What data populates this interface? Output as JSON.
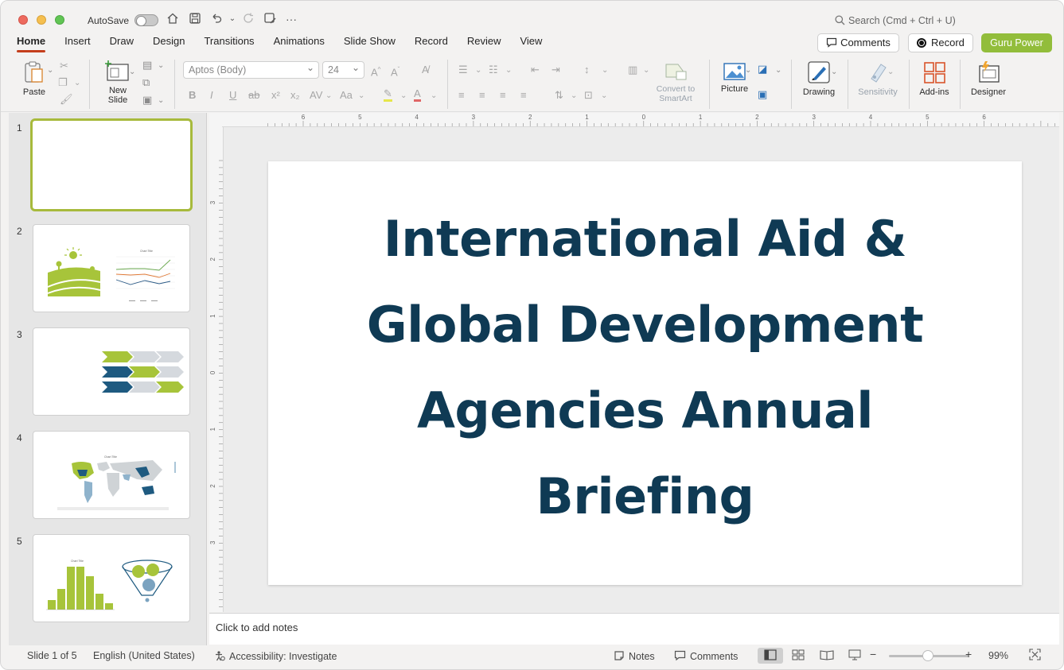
{
  "titlebar": {
    "autosave_label": "AutoSave",
    "search_placeholder": "Search (Cmd + Ctrl + U)"
  },
  "menu": {
    "tabs": [
      "Home",
      "Insert",
      "Draw",
      "Design",
      "Transitions",
      "Animations",
      "Slide Show",
      "Record",
      "Review",
      "View"
    ],
    "active": "Home",
    "comments_label": "Comments",
    "record_label": "Record",
    "guru_label": "Guru Power"
  },
  "ribbon": {
    "paste_label": "Paste",
    "new_slide_label": "New Slide",
    "font_name": "Aptos (Body)",
    "font_size": "24",
    "smartart_label": "Convert to SmartArt",
    "picture_label": "Picture",
    "drawing_label": "Drawing",
    "sensitivity_label": "Sensitivity",
    "addins_label": "Add-ins",
    "designer_label": "Designer",
    "accent_color": "#92bd3b"
  },
  "thumbnails": {
    "numbers": [
      "1",
      "2",
      "3",
      "4",
      "5"
    ],
    "thumb4_title": "Chart Title",
    "thumb5_title": "Chart Title",
    "thumb2_title": "Chart Title"
  },
  "ruler": {
    "h_labels": [
      "6",
      "5",
      "4",
      "3",
      "2",
      "1",
      "0",
      "1",
      "2",
      "3",
      "4",
      "5",
      "6"
    ],
    "v_labels": [
      "3",
      "2",
      "1",
      "0",
      "1",
      "2",
      "3"
    ]
  },
  "slide": {
    "title": "International Aid & Global Development Agencies Annual Briefing",
    "title_color": "#0f3a54"
  },
  "notes": {
    "placeholder": "Click to add notes"
  },
  "status": {
    "slide_counter": "Slide 1 of 5",
    "language": "English (United States)",
    "accessibility": "Accessibility: Investigate",
    "notes_label": "Notes",
    "comments_label": "Comments",
    "zoom_level": "99%",
    "zoom_fraction": 0.49
  }
}
